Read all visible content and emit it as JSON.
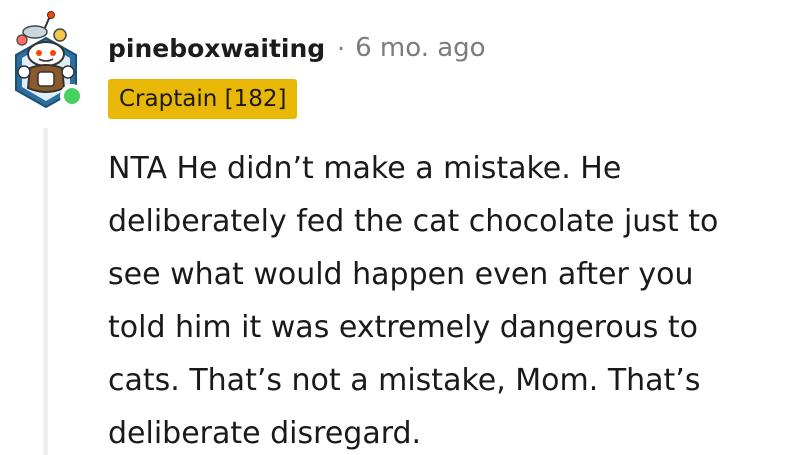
{
  "comment": {
    "author": "pineboxwaiting",
    "separator": "·",
    "timestamp": "6 mo. ago",
    "flair": "Craptain [182]",
    "body": "NTA He didn’t make a mistake. He\ndeliberately fed the cat chocolate just to\nsee what would happen even after you\ntold him it was extremely dangerous to\ncats. That’s not a mistake, Mom. That’s\ndeliberate disregard."
  },
  "avatar": {
    "icon": "snoo-avatar-icon",
    "online_status": "online",
    "online_color": "#46d160"
  },
  "colors": {
    "flair_background": "#e9b705",
    "meta_text": "#7c7c7c",
    "body_text": "#1a1a1b",
    "thread_line": "#edeff1"
  }
}
